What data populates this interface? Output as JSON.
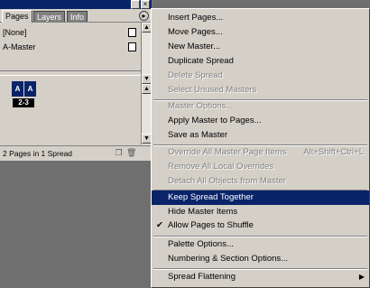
{
  "palette": {
    "tabs": [
      "Pages",
      "Layers",
      "Info"
    ],
    "masters": [
      "[None]",
      "A-Master"
    ],
    "spread": {
      "page_letters": [
        "A",
        "A"
      ],
      "label": "2-3"
    },
    "status": "2 Pages in 1 Spread",
    "close_glyph": "×",
    "menu_glyph": "▸",
    "scroll_up": "▲",
    "scroll_down": "▼",
    "new_page_glyph": "❐",
    "trash_glyph": "🗑"
  },
  "menu": {
    "items": [
      {
        "label": "Insert Pages...",
        "enabled": true
      },
      {
        "label": "Move Pages...",
        "enabled": true
      },
      {
        "label": "New Master...",
        "enabled": true
      },
      {
        "label": "Duplicate Spread",
        "enabled": true
      },
      {
        "label": "Delete Spread",
        "enabled": false
      },
      {
        "label": "Select Unused Masters",
        "enabled": false
      },
      {
        "label": "Master Options...",
        "enabled": false
      },
      {
        "label": "Apply Master to Pages...",
        "enabled": true
      },
      {
        "label": "Save as Master",
        "enabled": true
      },
      {
        "label": "Override All Master Page Items",
        "shortcut": "Alt+Shift+Ctrl+L",
        "enabled": false
      },
      {
        "label": "Remove All Local Overrides",
        "enabled": false
      },
      {
        "label": "Detach All Objects from Master",
        "enabled": false
      },
      {
        "label": "Keep Spread Together",
        "enabled": true,
        "highlighted": true
      },
      {
        "label": "Hide Master Items",
        "enabled": true
      },
      {
        "label": "Allow Pages to Shuffle",
        "enabled": true,
        "checked": true
      },
      {
        "label": "Palette Options...",
        "enabled": true
      },
      {
        "label": "Numbering & Section Options...",
        "enabled": true
      },
      {
        "label": "Spread Flattening",
        "enabled": true,
        "submenu": true
      }
    ],
    "check_glyph": "✔",
    "submenu_glyph": "▶"
  }
}
